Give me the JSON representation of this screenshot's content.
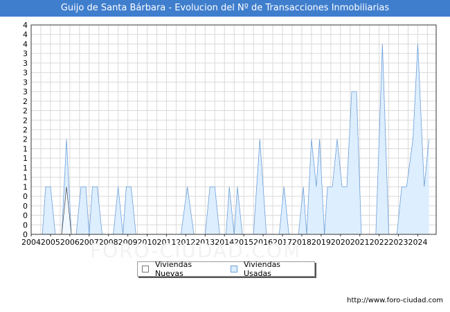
{
  "header": {
    "title": "Guijo de Santa Bárbara - Evolucion del Nº de Transacciones Inmobiliarias"
  },
  "footer": {
    "url": "http://www.foro-ciudad.com"
  },
  "watermark": {
    "text": "FORO-CIUDAD.COM"
  },
  "colors": {
    "title_bg": "#3f7ecd",
    "usadas_fill": "#ddeeff",
    "usadas_line": "#6d9fd8",
    "nuevas_fill": "#ffffff",
    "nuevas_line": "#555555",
    "grid": "#d9d9d9"
  },
  "chart_data": {
    "type": "area",
    "xlim": [
      2004,
      2024.95
    ],
    "ylim": [
      0,
      4.4
    ],
    "y_ticks": [
      0,
      0.2,
      0.4,
      0.6,
      0.8,
      1.0,
      1.2,
      1.4,
      1.6,
      1.8,
      2.0,
      2.2,
      2.4,
      2.6,
      2.8,
      3.0,
      3.2,
      3.4,
      3.6,
      3.8,
      4.0,
      4.2,
      4.4
    ],
    "y_tick_labels": [
      "0",
      "0",
      "0",
      "0",
      "0",
      "1",
      "1",
      "1",
      "1",
      "1",
      "2",
      "2",
      "2",
      "2",
      "2",
      "3",
      "3",
      "3",
      "3",
      "3",
      "4",
      "4",
      "4"
    ],
    "x_tick_labels": [
      "2004",
      "2005",
      "2006",
      "2007",
      "2008",
      "2009",
      "2010",
      "2011",
      "2012",
      "2013",
      "2014",
      "2015",
      "2016",
      "2017",
      "2018",
      "2019",
      "2020",
      "2021",
      "2022",
      "2023",
      "2024"
    ],
    "grid": true,
    "legend_position": "bottom-center",
    "series": [
      {
        "name": "Viviendas Usadas",
        "points": [
          [
            2004.58,
            0
          ],
          [
            2004.75,
            1
          ],
          [
            2005.0,
            1
          ],
          [
            2005.25,
            0
          ],
          [
            2005.58,
            0
          ],
          [
            2005.83,
            2
          ],
          [
            2006.08,
            0
          ],
          [
            2006.33,
            0
          ],
          [
            2006.58,
            1
          ],
          [
            2006.83,
            1
          ],
          [
            2007.0,
            0
          ],
          [
            2007.17,
            1
          ],
          [
            2007.42,
            1
          ],
          [
            2007.67,
            0
          ],
          [
            2008.25,
            0
          ],
          [
            2008.5,
            1
          ],
          [
            2008.75,
            0
          ],
          [
            2008.92,
            1
          ],
          [
            2009.17,
            1
          ],
          [
            2009.42,
            0
          ],
          [
            2011.75,
            0
          ],
          [
            2012.08,
            1
          ],
          [
            2012.42,
            0
          ],
          [
            2013.0,
            0
          ],
          [
            2013.25,
            1
          ],
          [
            2013.5,
            1
          ],
          [
            2013.75,
            0
          ],
          [
            2014.08,
            0
          ],
          [
            2014.25,
            1
          ],
          [
            2014.5,
            0
          ],
          [
            2014.67,
            1
          ],
          [
            2014.92,
            0
          ],
          [
            2015.5,
            0
          ],
          [
            2015.83,
            2
          ],
          [
            2016.17,
            0
          ],
          [
            2016.83,
            0
          ],
          [
            2017.08,
            1
          ],
          [
            2017.33,
            0
          ],
          [
            2017.83,
            0
          ],
          [
            2018.08,
            1
          ],
          [
            2018.25,
            0
          ],
          [
            2018.5,
            2
          ],
          [
            2018.75,
            1
          ],
          [
            2018.92,
            2
          ],
          [
            2019.17,
            0
          ],
          [
            2019.33,
            1
          ],
          [
            2019.58,
            1
          ],
          [
            2019.83,
            2
          ],
          [
            2020.08,
            1
          ],
          [
            2020.33,
            1
          ],
          [
            2020.58,
            3
          ],
          [
            2020.83,
            3
          ],
          [
            2021.08,
            0
          ],
          [
            2021.83,
            0
          ],
          [
            2022.17,
            4
          ],
          [
            2022.5,
            0
          ],
          [
            2022.92,
            0
          ],
          [
            2023.17,
            1
          ],
          [
            2023.42,
            1
          ],
          [
            2023.75,
            2
          ],
          [
            2024.0,
            4
          ],
          [
            2024.33,
            1
          ],
          [
            2024.58,
            2
          ]
        ]
      },
      {
        "name": "Viviendas Nuevas",
        "points": [
          [
            2005.58,
            0
          ],
          [
            2005.83,
            1
          ],
          [
            2006.08,
            0
          ]
        ]
      }
    ]
  },
  "legend": {
    "items": [
      {
        "label": "Viviendas Nuevas"
      },
      {
        "label": "Viviendas Usadas"
      }
    ]
  }
}
